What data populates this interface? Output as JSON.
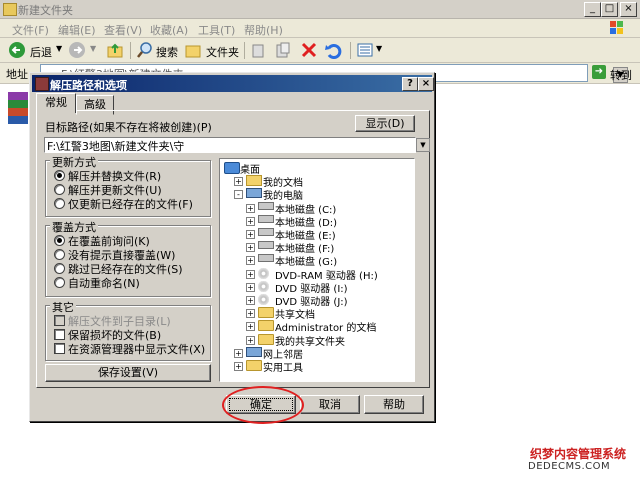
{
  "window": {
    "title": "新建文件夹"
  },
  "menu": [
    "文件(F)",
    "编辑(E)",
    "查看(V)",
    "收藏(A)",
    "工具(T)",
    "帮助(H)"
  ],
  "toolbar": {
    "back": "后退",
    "search": "搜索",
    "folders": "文件夹"
  },
  "address": {
    "label": "地址",
    "value": "F:\\红警3地图\\新建文件夹",
    "go": "转到"
  },
  "dialog": {
    "title": "解压路径和选项",
    "tabs": [
      "常规",
      "高级"
    ],
    "target_label": "目标路径(如果不存在将被创建)(P)",
    "show_button": "显示(D)",
    "path_value": "F:\\红警3地图\\新建文件夹\\守",
    "update_group": {
      "title": "更新方式",
      "options": [
        "解压并替换文件(R)",
        "解压并更新文件(U)",
        "仅更新已经存在的文件(F)"
      ],
      "selected": 0
    },
    "overwrite_group": {
      "title": "覆盖方式",
      "options": [
        "在覆盖前询问(K)",
        "没有提示直接覆盖(W)",
        "跳过已经存在的文件(S)",
        "自动重命名(N)"
      ],
      "selected": 0
    },
    "misc_group": {
      "title": "其它",
      "options": [
        "解压文件到子目录(L)",
        "保留损坏的文件(B)",
        "在资源管理器中显示文件(X)"
      ],
      "disabled": [
        true,
        false,
        false
      ]
    },
    "save_button": "保存设置(V)",
    "tree": [
      {
        "label": "桌面",
        "icon": "desktop-icon",
        "indent": 0,
        "expander": ""
      },
      {
        "label": "我的文档",
        "icon": "my-documents-icon",
        "indent": 1,
        "expander": "+"
      },
      {
        "label": "我的电脑",
        "icon": "my-computer-icon",
        "indent": 1,
        "expander": "-"
      },
      {
        "label": "本地磁盘 (C:)",
        "icon": "drive-icon",
        "indent": 2,
        "expander": "+"
      },
      {
        "label": "本地磁盘 (D:)",
        "icon": "drive-icon",
        "indent": 2,
        "expander": "+"
      },
      {
        "label": "本地磁盘 (E:)",
        "icon": "drive-icon",
        "indent": 2,
        "expander": "+"
      },
      {
        "label": "本地磁盘 (F:)",
        "icon": "drive-icon",
        "indent": 2,
        "expander": "+"
      },
      {
        "label": "本地磁盘 (G:)",
        "icon": "drive-icon",
        "indent": 2,
        "expander": "+"
      },
      {
        "label": "DVD-RAM 驱动器 (H:)",
        "icon": "cd-drive-icon",
        "indent": 2,
        "expander": "+"
      },
      {
        "label": "DVD 驱动器 (I:)",
        "icon": "cd-drive-icon",
        "indent": 2,
        "expander": "+"
      },
      {
        "label": "DVD 驱动器 (J:)",
        "icon": "cd-drive-icon",
        "indent": 2,
        "expander": "+"
      },
      {
        "label": "共享文档",
        "icon": "folder-icon",
        "indent": 2,
        "expander": "+"
      },
      {
        "label": "Administrator 的文档",
        "icon": "folder-icon",
        "indent": 2,
        "expander": "+"
      },
      {
        "label": "我的共享文件夹",
        "icon": "shared-folder-icon",
        "indent": 2,
        "expander": "+"
      },
      {
        "label": "网上邻居",
        "icon": "network-icon",
        "indent": 1,
        "expander": "+"
      },
      {
        "label": "实用工具",
        "icon": "folder-icon",
        "indent": 1,
        "expander": "+"
      }
    ],
    "ok_button": "确定",
    "cancel_button": "取消",
    "help_button": "帮助"
  },
  "watermark": {
    "line1": "织梦内容管理系统",
    "line2": "DEDECMS.COM"
  }
}
